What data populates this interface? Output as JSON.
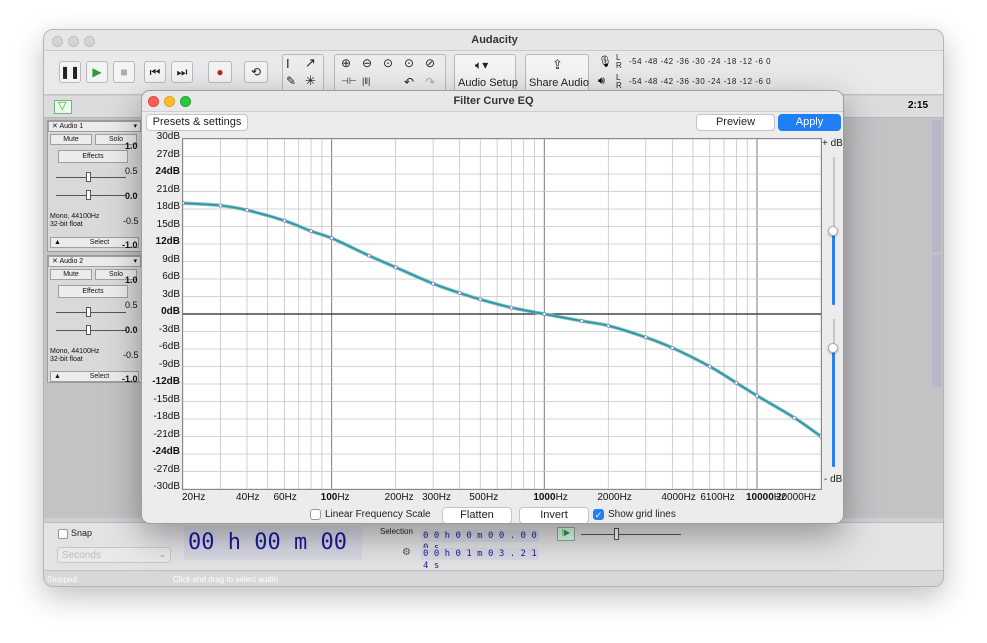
{
  "app": {
    "title": "Audacity",
    "toolbar": {
      "audio_setup": "Audio Setup",
      "share_audio": "Share Audio",
      "meter_scale_top": "-54  -48  -42  -36  -30  -24  -18  -12   -6   0",
      "meter_scale_bottom": "-54  -48  -42  -36  -30  -24  -18  -12   -6   0",
      "meter_L": "L",
      "meter_R": "R"
    },
    "ruler": {
      "time_label": "2:15"
    },
    "tracks": [
      {
        "name": "Audio 1",
        "mute": "Mute",
        "solo": "Solo",
        "effects": "Effects",
        "info": "Mono, 44100Hz",
        "format": "32-bit float",
        "select": "Select",
        "scale": [
          "1.0",
          "0.5",
          "0.0",
          "-0.5",
          "-1.0"
        ]
      },
      {
        "name": "Audio 2",
        "mute": "Mute",
        "solo": "Solo",
        "effects": "Effects",
        "info": "Mono, 44100Hz",
        "format": "32-bit float",
        "select": "Select",
        "scale": [
          "1.0",
          "0.5",
          "0.0",
          "-0.5",
          "-1.0"
        ]
      }
    ],
    "bottom": {
      "snap": "Snap",
      "units": "Seconds",
      "time_display": "00 h 00 m 00 s",
      "selection_label": "Selection",
      "sel_start": "0 0 h 0 0 m 0 0 . 0 0 0 s",
      "sel_end": "0 0 h 0 1 m 0 3 . 2 1 4 s"
    },
    "status": {
      "state": "Stopped.",
      "hint": "Click and drag to select audio"
    }
  },
  "dialog": {
    "title": "Filter Curve EQ",
    "presets": "Presets & settings",
    "preview": "Preview",
    "apply": "Apply",
    "plus_db": "+ dB",
    "minus_db": "- dB",
    "linear_label": "Linear Frequency Scale",
    "linear_checked": false,
    "flatten": "Flatten",
    "invert": "Invert",
    "grid_label": "Show grid lines",
    "grid_checked": true,
    "slider_top_level": 0.75,
    "slider_bottom_level": 0.5
  },
  "chart_data": {
    "type": "line",
    "x_scale": "log",
    "xlim": [
      20,
      20000
    ],
    "ylim": [
      -30,
      30
    ],
    "grid": true,
    "y_ticks": [
      "30dB",
      "27dB",
      "24dB",
      "21dB",
      "18dB",
      "15dB",
      "12dB",
      "9dB",
      "6dB",
      "3dB",
      "0dB",
      "-3dB",
      "-6dB",
      "-9dB",
      "-12dB",
      "-15dB",
      "-18dB",
      "-21dB",
      "-24dB",
      "-27dB",
      "-30dB"
    ],
    "y_bold": [
      "24dB",
      "12dB",
      "0dB",
      "-12dB",
      "-24dB"
    ],
    "x_ticks": [
      {
        "label": "20Hz",
        "v": 20
      },
      {
        "label": "40Hz",
        "v": 40
      },
      {
        "label": "60Hz",
        "v": 60
      },
      {
        "label": "100Hz",
        "v": 100,
        "bold": true
      },
      {
        "label": "200Hz",
        "v": 200
      },
      {
        "label": "300Hz",
        "v": 300
      },
      {
        "label": "500Hz",
        "v": 500
      },
      {
        "label": "1000Hz",
        "v": 1000,
        "bold": true
      },
      {
        "label": "2000Hz",
        "v": 2000
      },
      {
        "label": "4000Hz",
        "v": 4000
      },
      {
        "label": "6100Hz",
        "v": 6100
      },
      {
        "label": "10000Hz",
        "v": 10000,
        "bold": true
      },
      {
        "label": "20000Hz",
        "v": 20000
      }
    ],
    "series": [
      {
        "color": "#2c8fc4",
        "x": [
          20,
          30,
          40,
          60,
          80,
          100,
          150,
          200,
          300,
          400,
          500,
          700,
          1000,
          1500,
          2000,
          3000,
          4000,
          6000,
          8000,
          10000,
          15000,
          20000
        ],
        "y": [
          19.0,
          18.6,
          17.8,
          16.0,
          14.2,
          13.0,
          10.0,
          8.0,
          5.2,
          3.6,
          2.5,
          1.1,
          0.0,
          -1.2,
          -2.0,
          -4.0,
          -5.8,
          -9.0,
          -11.8,
          -14.0,
          -17.8,
          -21.0
        ]
      }
    ]
  }
}
